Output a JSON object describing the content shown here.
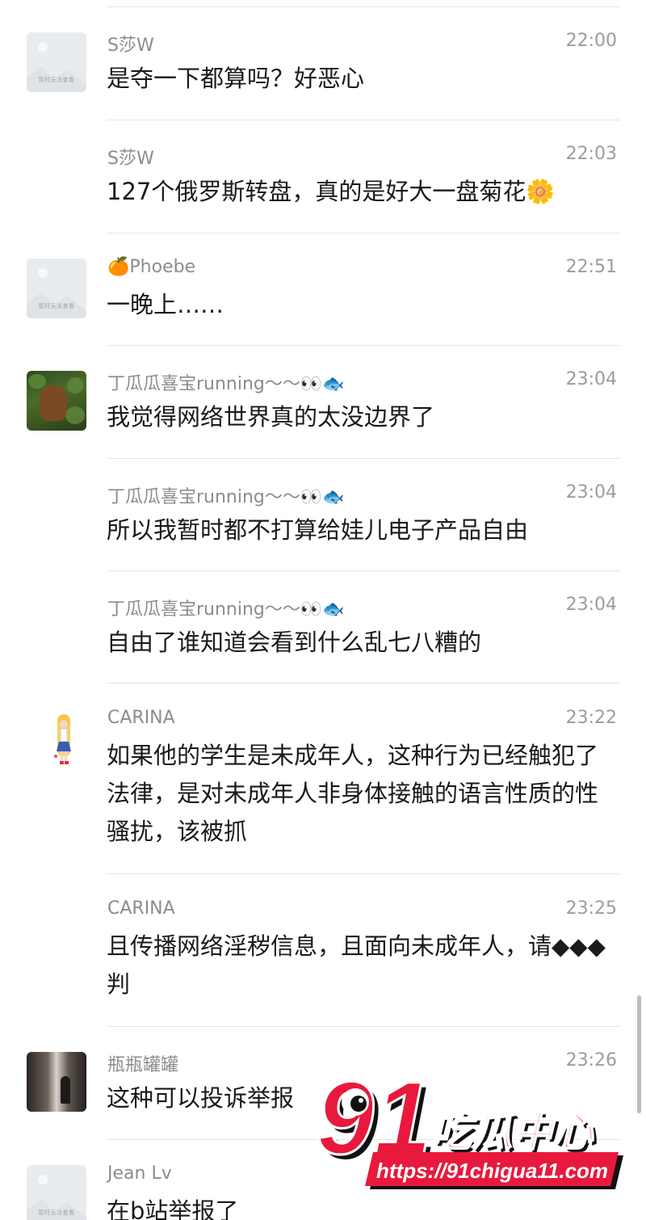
{
  "messages": [
    {
      "sender": "S莎W",
      "time": "22:00",
      "text": "是夺一下都算吗？好恶心",
      "avatar": "placeholder"
    },
    {
      "sender": "S莎W",
      "time": "22:03",
      "text": "127个俄罗斯转盘，真的是好大一盘菊花🌼",
      "avatar": "none"
    },
    {
      "sender": "Phoebe",
      "sender_emoji": "🍊",
      "time": "22:51",
      "text": "一晚上……",
      "avatar": "placeholder"
    },
    {
      "sender": "丁瓜瓜喜宝running～～👀🐟",
      "time": "23:04",
      "text": "我觉得网络世界真的太没边界了",
      "avatar": "forest-dog"
    },
    {
      "sender": "丁瓜瓜喜宝running～～👀🐟",
      "time": "23:04",
      "text": "所以我暂时都不打算给娃儿电子产品自由",
      "avatar": "none"
    },
    {
      "sender": "丁瓜瓜喜宝running～～👀🐟",
      "time": "23:04",
      "text": "自由了谁知道会看到什么乱七八糟的",
      "avatar": "none"
    },
    {
      "sender": "CARINA",
      "time": "23:22",
      "text": "如果他的学生是未成年人，这种行为已经触犯了法律，是对未成年人非身体接触的语言性质的性骚扰，该被抓",
      "avatar": "anime-figure"
    },
    {
      "sender": "CARINA",
      "time": "23:25",
      "text": "且传播网络淫秽信息，且面向未成年人，请◆◆◆判",
      "avatar": "none"
    },
    {
      "sender": "瓶瓶罐罐",
      "time": "23:26",
      "text": "这种可以投诉举报",
      "avatar": "dark-room"
    },
    {
      "sender": "Jean Lv",
      "time": "",
      "text": "在b站举报了",
      "avatar": "placeholder"
    }
  ],
  "placeholder_avatar_text": "暂时无法查看",
  "watermark": {
    "number": "91",
    "brand": "吃瓜中心",
    "url": "https://91chigua11.com",
    "colors": {
      "red": "#e8193c",
      "white": "#ffffff",
      "black": "#111111"
    }
  },
  "colors": {
    "name": "#8c8c8c",
    "time": "#9c9c9c",
    "text": "#1a1a1a",
    "divider": "#e6e6e6"
  }
}
